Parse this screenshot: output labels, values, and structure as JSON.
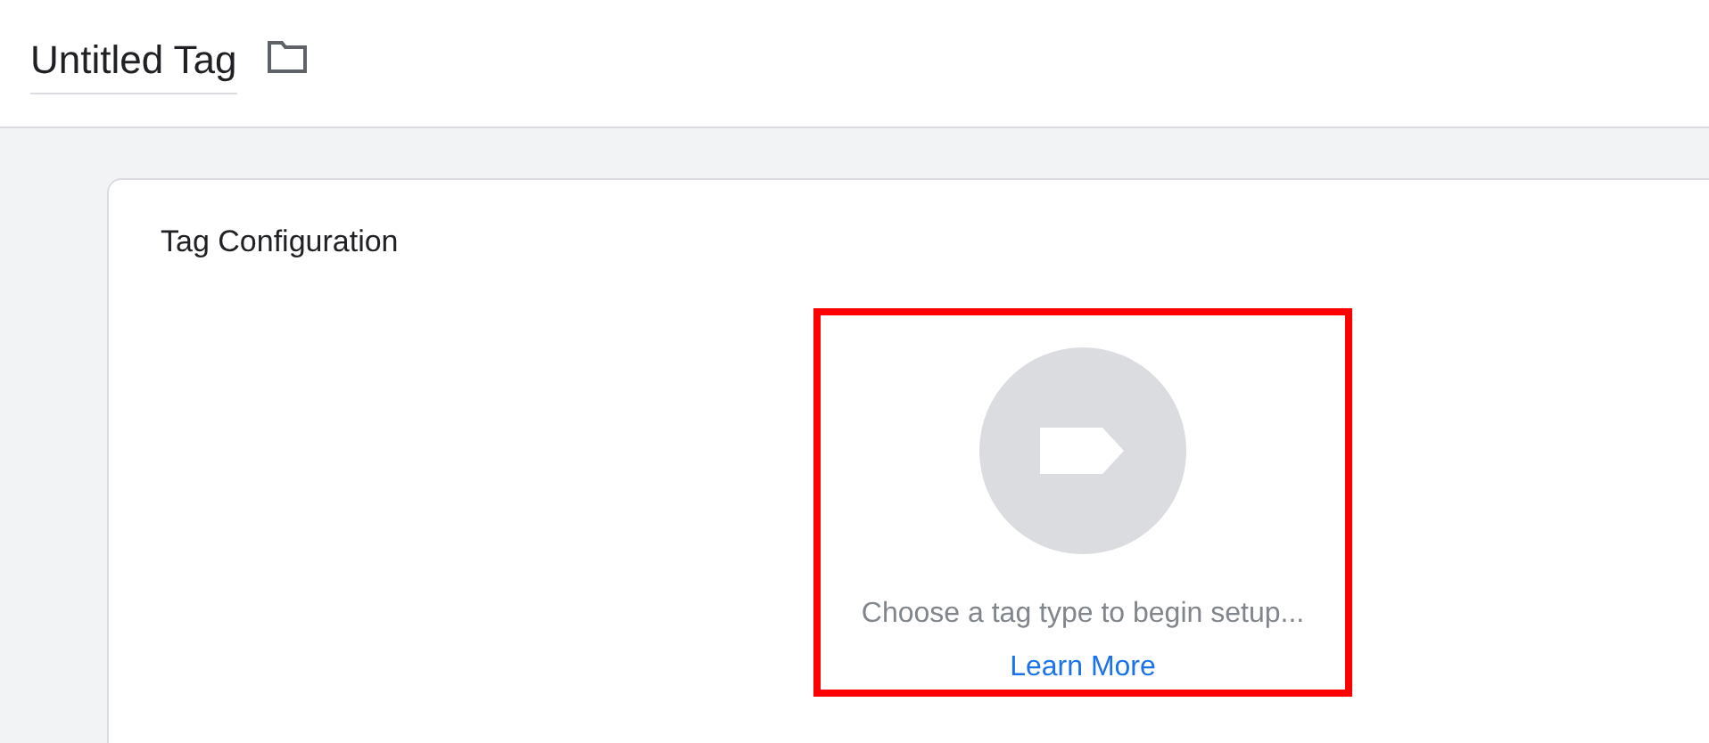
{
  "header": {
    "title": "Untitled Tag"
  },
  "card": {
    "title": "Tag Configuration",
    "prompt": "Choose a tag type to begin setup...",
    "link": "Learn More"
  }
}
